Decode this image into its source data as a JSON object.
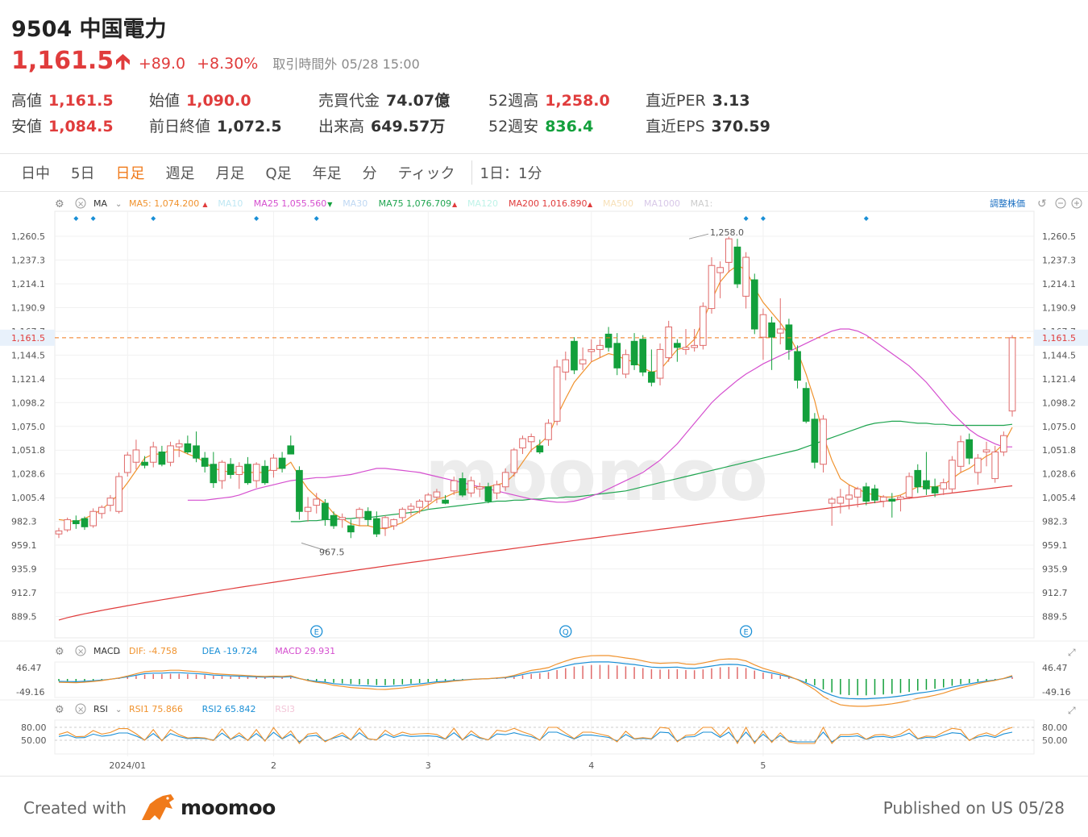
{
  "header": {
    "title": "9504 中国電力",
    "price": "1,161.5",
    "change": "+89.0",
    "change_pct": "+8.30%",
    "status": "取引時間外  05/28 15:00"
  },
  "stats": [
    {
      "label": "高値",
      "value": "1,161.5",
      "color": "red"
    },
    {
      "label": "安値",
      "value": "1,084.5",
      "color": "red"
    },
    {
      "label": "始値",
      "value": "1,090.0",
      "color": "red"
    },
    {
      "label": "前日終値",
      "value": "1,072.5",
      "color": "dark"
    },
    {
      "label": "売買代金",
      "value": "74.07億",
      "color": "dark"
    },
    {
      "label": "出来高",
      "value": "649.57万",
      "color": "dark"
    },
    {
      "label": "52週高",
      "value": "1,258.0",
      "color": "red"
    },
    {
      "label": "52週安",
      "value": "836.4",
      "color": "green"
    },
    {
      "label": "直近PER",
      "value": "3.13",
      "color": "dark"
    },
    {
      "label": "直近EPS",
      "value": "370.59",
      "color": "dark"
    }
  ],
  "tabs": [
    "日中",
    "5日",
    "日足",
    "週足",
    "月足",
    "Q足",
    "年足",
    "分",
    "ティック",
    "1日：1分"
  ],
  "active_tab": "日足",
  "indicators": {
    "main_label": "MA",
    "ma_items": [
      {
        "name": "MA5:",
        "value": "1,074.200",
        "color": "#f0922d",
        "arrow": "up"
      },
      {
        "name": "MA10",
        "value": "",
        "color": "#bfe7f3",
        "arrow": ""
      },
      {
        "name": "MA25",
        "value": "1,055.560",
        "color": "#d54fcf",
        "arrow": "down"
      },
      {
        "name": "MA30",
        "value": "",
        "color": "#bfd8f3",
        "arrow": ""
      },
      {
        "name": "MA75",
        "value": "1,076.709",
        "color": "#1fa550",
        "arrow": "up"
      },
      {
        "name": "MA120",
        "value": "",
        "color": "#bff3e8",
        "arrow": ""
      },
      {
        "name": "MA200",
        "value": "1,016.890",
        "color": "#e03c3c",
        "arrow": "up"
      },
      {
        "name": "MA500",
        "value": "",
        "color": "#f7e0b8",
        "arrow": ""
      },
      {
        "name": "MA1000",
        "value": "",
        "color": "#d8c8e8",
        "arrow": ""
      },
      {
        "name": "MA1:",
        "value": "",
        "color": "#cccccc",
        "arrow": ""
      }
    ],
    "adjust_label": "調整株価",
    "macd_label": "MACD",
    "macd_items": [
      {
        "name": "DIF:",
        "value": "-4.758",
        "color": "#f0922d"
      },
      {
        "name": "DEA",
        "value": "-19.724",
        "color": "#1a8fd6"
      },
      {
        "name": "MACD",
        "value": "29.931",
        "color": "#d54fcf"
      }
    ],
    "macd_ticks": [
      "46.47",
      "-49.16"
    ],
    "rsi_label": "RSI",
    "rsi_items": [
      {
        "name": "RSI1",
        "value": "75.866",
        "color": "#f0922d"
      },
      {
        "name": "RSI2",
        "value": "65.842",
        "color": "#1a8fd6"
      },
      {
        "name": "RSI3",
        "value": "",
        "color": "#f3c6d8"
      }
    ],
    "rsi_ticks": [
      "80.00",
      "50.00"
    ]
  },
  "chart_data": {
    "type": "candlestick",
    "y_ticks": [
      1260.5,
      1237.3,
      1214.1,
      1190.9,
      1167.7,
      1144.5,
      1121.4,
      1098.2,
      1075.0,
      1051.8,
      1028.6,
      1005.4,
      982.3,
      959.1,
      935.9,
      912.7,
      889.5
    ],
    "y_tick_labels": [
      "1,260.5",
      "1,237.3",
      "1,214.1",
      "1,190.9",
      "1,167.7",
      "1,144.5",
      "1,121.4",
      "1,098.2",
      "1,075.0",
      "1,051.8",
      "1,028.6",
      "1,005.4",
      "982.3",
      "959.1",
      "935.9",
      "912.7",
      "889.5"
    ],
    "ylim": [
      876,
      1276
    ],
    "current_price": 1161.5,
    "current_price_label": "1,161.5",
    "high_marker": {
      "value": 1258.0,
      "label": "1,258.0",
      "index": 73
    },
    "low_marker": {
      "value": 967.5,
      "label": "967.5",
      "index": 32
    },
    "x_labels": [
      {
        "label": "2024/01",
        "index": 8
      },
      {
        "label": "2",
        "index": 25
      },
      {
        "label": "3",
        "index": 43
      },
      {
        "label": "4",
        "index": 62
      },
      {
        "label": "5",
        "index": 82
      }
    ],
    "events": [
      {
        "label": "E",
        "index": 30
      },
      {
        "label": "Q",
        "index": 59
      },
      {
        "label": "E",
        "index": 80
      }
    ],
    "dividend_dots": [
      2,
      4,
      11,
      23,
      30,
      80,
      82,
      94
    ],
    "candles": [
      {
        "o": 970,
        "h": 976,
        "l": 966,
        "c": 973
      },
      {
        "o": 974,
        "h": 986,
        "l": 972,
        "c": 984
      },
      {
        "o": 983,
        "h": 988,
        "l": 975,
        "c": 980
      },
      {
        "o": 985,
        "h": 987,
        "l": 974,
        "c": 977
      },
      {
        "o": 978,
        "h": 995,
        "l": 976,
        "c": 992
      },
      {
        "o": 990,
        "h": 998,
        "l": 985,
        "c": 996
      },
      {
        "o": 998,
        "h": 1008,
        "l": 992,
        "c": 1005
      },
      {
        "o": 992,
        "h": 1030,
        "l": 990,
        "c": 1026
      },
      {
        "o": 1030,
        "h": 1050,
        "l": 1026,
        "c": 1047
      },
      {
        "o": 1040,
        "h": 1062,
        "l": 1033,
        "c": 1052
      },
      {
        "o": 1040,
        "h": 1046,
        "l": 1034,
        "c": 1037
      },
      {
        "o": 1040,
        "h": 1060,
        "l": 1035,
        "c": 1055
      },
      {
        "o": 1050,
        "h": 1056,
        "l": 1036,
        "c": 1038
      },
      {
        "o": 1040,
        "h": 1060,
        "l": 1036,
        "c": 1056
      },
      {
        "o": 1055,
        "h": 1062,
        "l": 1045,
        "c": 1058
      },
      {
        "o": 1058,
        "h": 1066,
        "l": 1048,
        "c": 1050
      },
      {
        "o": 1056,
        "h": 1070,
        "l": 1040,
        "c": 1044
      },
      {
        "o": 1044,
        "h": 1050,
        "l": 1030,
        "c": 1036
      },
      {
        "o": 1038,
        "h": 1050,
        "l": 1015,
        "c": 1020
      },
      {
        "o": 1022,
        "h": 1042,
        "l": 1014,
        "c": 1040
      },
      {
        "o": 1038,
        "h": 1044,
        "l": 1024,
        "c": 1028
      },
      {
        "o": 1028,
        "h": 1040,
        "l": 1014,
        "c": 1036
      },
      {
        "o": 1038,
        "h": 1045,
        "l": 1018,
        "c": 1020
      },
      {
        "o": 1022,
        "h": 1040,
        "l": 1015,
        "c": 1038
      },
      {
        "o": 1036,
        "h": 1042,
        "l": 1018,
        "c": 1020
      },
      {
        "o": 1032,
        "h": 1048,
        "l": 1025,
        "c": 1044
      },
      {
        "o": 1044,
        "h": 1050,
        "l": 1030,
        "c": 1034
      },
      {
        "o": 1056,
        "h": 1066,
        "l": 1050,
        "c": 1048
      },
      {
        "o": 1032,
        "h": 1036,
        "l": 984,
        "c": 992
      },
      {
        "o": 992,
        "h": 1006,
        "l": 982,
        "c": 996
      },
      {
        "o": 998,
        "h": 1010,
        "l": 990,
        "c": 1004
      },
      {
        "o": 1000,
        "h": 1004,
        "l": 978,
        "c": 984
      },
      {
        "o": 988,
        "h": 992,
        "l": 975,
        "c": 978
      },
      {
        "o": 984,
        "h": 990,
        "l": 976,
        "c": 986
      },
      {
        "o": 978,
        "h": 984,
        "l": 966,
        "c": 972
      },
      {
        "o": 986,
        "h": 996,
        "l": 978,
        "c": 994
      },
      {
        "o": 992,
        "h": 996,
        "l": 978,
        "c": 984
      },
      {
        "o": 985,
        "h": 992,
        "l": 967,
        "c": 970
      },
      {
        "o": 976,
        "h": 988,
        "l": 968,
        "c": 986
      },
      {
        "o": 978,
        "h": 985,
        "l": 974,
        "c": 984
      },
      {
        "o": 986,
        "h": 996,
        "l": 982,
        "c": 994
      },
      {
        "o": 994,
        "h": 1000,
        "l": 988,
        "c": 997
      },
      {
        "o": 996,
        "h": 1004,
        "l": 990,
        "c": 1002
      },
      {
        "o": 1002,
        "h": 1010,
        "l": 994,
        "c": 1008
      },
      {
        "o": 1006,
        "h": 1014,
        "l": 1000,
        "c": 1011
      },
      {
        "o": 1003,
        "h": 1008,
        "l": 999,
        "c": 1000
      },
      {
        "o": 1012,
        "h": 1026,
        "l": 1008,
        "c": 1022
      },
      {
        "o": 1024,
        "h": 1030,
        "l": 1006,
        "c": 1008
      },
      {
        "o": 1010,
        "h": 1026,
        "l": 1006,
        "c": 1022
      },
      {
        "o": 1014,
        "h": 1020,
        "l": 1006,
        "c": 1016
      },
      {
        "o": 1016,
        "h": 1020,
        "l": 1000,
        "c": 1002
      },
      {
        "o": 1010,
        "h": 1022,
        "l": 1004,
        "c": 1018
      },
      {
        "o": 1016,
        "h": 1034,
        "l": 1012,
        "c": 1030
      },
      {
        "o": 1030,
        "h": 1054,
        "l": 1026,
        "c": 1052
      },
      {
        "o": 1054,
        "h": 1066,
        "l": 1048,
        "c": 1063
      },
      {
        "o": 1060,
        "h": 1068,
        "l": 1050,
        "c": 1065
      },
      {
        "o": 1056,
        "h": 1062,
        "l": 1048,
        "c": 1050
      },
      {
        "o": 1062,
        "h": 1082,
        "l": 1056,
        "c": 1078
      },
      {
        "o": 1080,
        "h": 1140,
        "l": 1076,
        "c": 1133
      },
      {
        "o": 1128,
        "h": 1148,
        "l": 1120,
        "c": 1140
      },
      {
        "o": 1158,
        "h": 1162,
        "l": 1126,
        "c": 1130
      },
      {
        "o": 1136,
        "h": 1152,
        "l": 1130,
        "c": 1140
      },
      {
        "o": 1148,
        "h": 1160,
        "l": 1138,
        "c": 1150
      },
      {
        "o": 1150,
        "h": 1160,
        "l": 1142,
        "c": 1154
      },
      {
        "o": 1165,
        "h": 1172,
        "l": 1148,
        "c": 1152
      },
      {
        "o": 1156,
        "h": 1166,
        "l": 1125,
        "c": 1132
      },
      {
        "o": 1126,
        "h": 1150,
        "l": 1122,
        "c": 1145
      },
      {
        "o": 1158,
        "h": 1166,
        "l": 1130,
        "c": 1135
      },
      {
        "o": 1160,
        "h": 1164,
        "l": 1124,
        "c": 1128
      },
      {
        "o": 1128,
        "h": 1150,
        "l": 1114,
        "c": 1118
      },
      {
        "o": 1122,
        "h": 1156,
        "l": 1115,
        "c": 1150
      },
      {
        "o": 1142,
        "h": 1178,
        "l": 1138,
        "c": 1172
      },
      {
        "o": 1156,
        "h": 1160,
        "l": 1138,
        "c": 1152
      },
      {
        "o": 1150,
        "h": 1170,
        "l": 1145,
        "c": 1152
      },
      {
        "o": 1152,
        "h": 1170,
        "l": 1148,
        "c": 1154
      },
      {
        "o": 1154,
        "h": 1196,
        "l": 1150,
        "c": 1192
      },
      {
        "o": 1190,
        "h": 1240,
        "l": 1185,
        "c": 1232
      },
      {
        "o": 1225,
        "h": 1236,
        "l": 1200,
        "c": 1230
      },
      {
        "o": 1235,
        "h": 1260,
        "l": 1225,
        "c": 1258
      },
      {
        "o": 1250,
        "h": 1258,
        "l": 1210,
        "c": 1214
      },
      {
        "o": 1202,
        "h": 1245,
        "l": 1190,
        "c": 1240
      },
      {
        "o": 1218,
        "h": 1224,
        "l": 1165,
        "c": 1170
      },
      {
        "o": 1162,
        "h": 1190,
        "l": 1140,
        "c": 1184
      },
      {
        "o": 1176,
        "h": 1182,
        "l": 1130,
        "c": 1162
      },
      {
        "o": 1166,
        "h": 1200,
        "l": 1155,
        "c": 1170
      },
      {
        "o": 1174,
        "h": 1180,
        "l": 1140,
        "c": 1150
      },
      {
        "o": 1148,
        "h": 1154,
        "l": 1112,
        "c": 1120
      },
      {
        "o": 1112,
        "h": 1118,
        "l": 1078,
        "c": 1080
      },
      {
        "o": 1082,
        "h": 1088,
        "l": 1034,
        "c": 1040
      },
      {
        "o": 1038,
        "h": 1086,
        "l": 1030,
        "c": 1082
      },
      {
        "o": 1000,
        "h": 1006,
        "l": 978,
        "c": 1004
      },
      {
        "o": 1000,
        "h": 1014,
        "l": 990,
        "c": 1006
      },
      {
        "o": 1004,
        "h": 1018,
        "l": 994,
        "c": 1008
      },
      {
        "o": 1006,
        "h": 1016,
        "l": 996,
        "c": 1014
      },
      {
        "o": 1016,
        "h": 1020,
        "l": 998,
        "c": 1002
      },
      {
        "o": 1014,
        "h": 1018,
        "l": 1000,
        "c": 1003
      },
      {
        "o": 1002,
        "h": 1008,
        "l": 996,
        "c": 1006
      },
      {
        "o": 1004,
        "h": 1010,
        "l": 986,
        "c": 1002
      },
      {
        "o": 1004,
        "h": 1008,
        "l": 992,
        "c": 1006
      },
      {
        "o": 1006,
        "h": 1030,
        "l": 1004,
        "c": 1026
      },
      {
        "o": 1032,
        "h": 1038,
        "l": 1010,
        "c": 1016
      },
      {
        "o": 1022,
        "h": 1050,
        "l": 1008,
        "c": 1014
      },
      {
        "o": 1016,
        "h": 1024,
        "l": 1006,
        "c": 1010
      },
      {
        "o": 1014,
        "h": 1024,
        "l": 1008,
        "c": 1020
      },
      {
        "o": 1014,
        "h": 1046,
        "l": 1010,
        "c": 1042
      },
      {
        "o": 1036,
        "h": 1066,
        "l": 1030,
        "c": 1060
      },
      {
        "o": 1062,
        "h": 1068,
        "l": 1038,
        "c": 1044
      },
      {
        "o": 1030,
        "h": 1048,
        "l": 1018,
        "c": 1044
      },
      {
        "o": 1050,
        "h": 1060,
        "l": 1036,
        "c": 1052
      },
      {
        "o": 1024,
        "h": 1056,
        "l": 1020,
        "c": 1050
      },
      {
        "o": 1050,
        "h": 1070,
        "l": 1046,
        "c": 1066
      },
      {
        "o": 1090,
        "h": 1164,
        "l": 1084.5,
        "c": 1161.5
      }
    ],
    "ma5": [
      984,
      983,
      982,
      985,
      989,
      994,
      1001,
      1009,
      1020,
      1032,
      1044,
      1048,
      1048,
      1052,
      1052,
      1048,
      1045,
      1040,
      1034,
      1032,
      1030,
      1030,
      1030,
      1030,
      1030,
      1034,
      1034,
      1040,
      1026,
      1014,
      1006,
      1000,
      990,
      985,
      980,
      978,
      978,
      976,
      975,
      978,
      981,
      987,
      992,
      998,
      1004,
      1006,
      1010,
      1012,
      1015,
      1016,
      1016,
      1018,
      1020,
      1028,
      1040,
      1052,
      1058,
      1066,
      1085,
      1102,
      1118,
      1128,
      1138,
      1142,
      1146,
      1144,
      1140,
      1138,
      1132,
      1128,
      1130,
      1140,
      1150,
      1152,
      1160,
      1178,
      1198,
      1216,
      1226,
      1232,
      1228,
      1210,
      1196,
      1186,
      1176,
      1164,
      1148,
      1126,
      1100,
      1066,
      1042,
      1024,
      1018,
      1014,
      1010,
      1008,
      1006,
      1006,
      1008,
      1012,
      1016,
      1016,
      1016,
      1018,
      1024,
      1030,
      1034,
      1040,
      1046,
      1050,
      1058,
      1074
    ],
    "ma25": [
      1003,
      1003,
      1003,
      1004,
      1005,
      1006,
      1008,
      1011,
      1014,
      1016,
      1018,
      1020,
      1022,
      1023,
      1024,
      1025,
      1025,
      1026,
      1027,
      1028,
      1030,
      1032,
      1034,
      1034,
      1033,
      1032,
      1031,
      1030,
      1028,
      1026,
      1024,
      1022,
      1020,
      1018,
      1016,
      1014,
      1012,
      1010,
      1008,
      1006,
      1004,
      1003,
      1002,
      1001,
      1001,
      1002,
      1004,
      1007,
      1010,
      1014,
      1018,
      1022,
      1026,
      1030,
      1036,
      1042,
      1050,
      1058,
      1068,
      1078,
      1088,
      1098,
      1106,
      1113,
      1120,
      1126,
      1131,
      1136,
      1140,
      1144,
      1148,
      1152,
      1156,
      1160,
      1164,
      1168,
      1170,
      1170,
      1168,
      1164,
      1158,
      1152,
      1146,
      1140,
      1134,
      1126,
      1118,
      1108,
      1098,
      1088,
      1080,
      1072,
      1066,
      1062,
      1058,
      1055,
      1055
    ],
    "ma75": [
      982,
      982,
      983,
      983,
      984,
      984,
      985,
      985,
      986,
      986,
      987,
      988,
      989,
      990,
      991,
      992,
      994,
      995,
      996,
      997,
      998,
      999,
      1000,
      1001,
      1002,
      1002,
      1003,
      1003,
      1004,
      1004,
      1005,
      1005,
      1006,
      1006,
      1007,
      1008,
      1009,
      1010,
      1011,
      1012,
      1014,
      1016,
      1018,
      1020,
      1022,
      1024,
      1026,
      1028,
      1030,
      1032,
      1034,
      1036,
      1038,
      1040,
      1042,
      1044,
      1046,
      1048,
      1050,
      1052,
      1055,
      1058,
      1061,
      1064,
      1067,
      1070,
      1073,
      1076,
      1078,
      1079,
      1080,
      1080,
      1079,
      1078,
      1078,
      1077,
      1077,
      1076,
      1076,
      1076,
      1076,
      1076,
      1076,
      1076,
      1077
    ],
    "ma200_start": 886,
    "ma200_end": 1017
  }
}
